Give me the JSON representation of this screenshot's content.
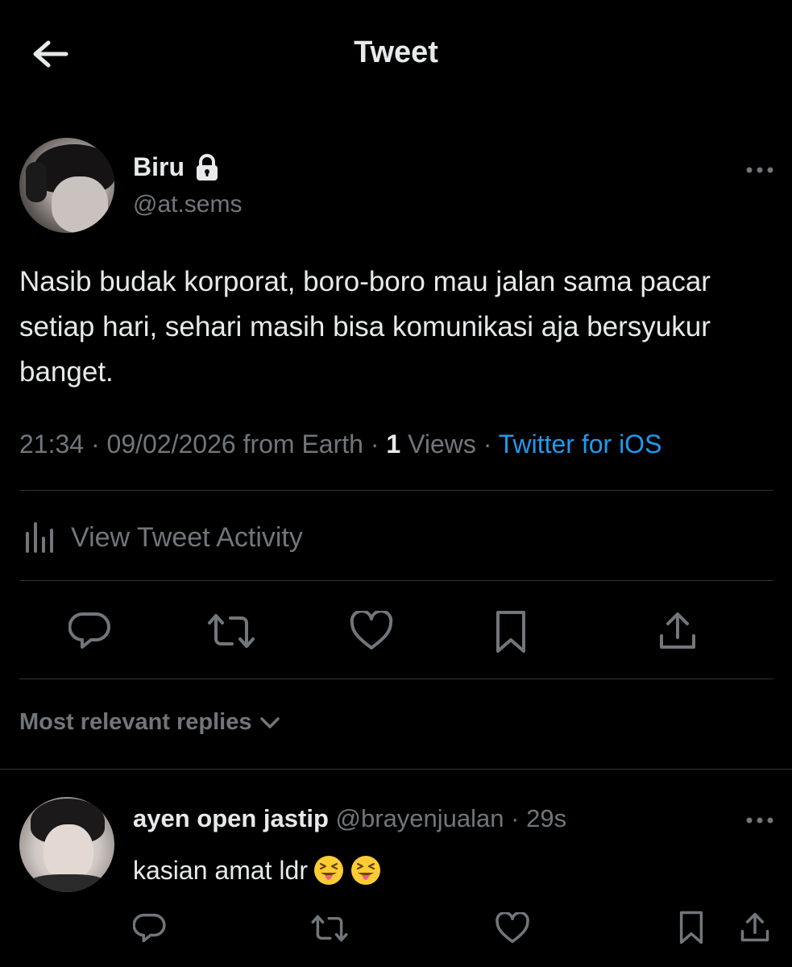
{
  "header": {
    "title": "Tweet",
    "back_icon": "arrow-left-icon"
  },
  "tweet": {
    "author": {
      "name": "Biru",
      "handle": "@at.sems",
      "protected_icon": "lock-icon"
    },
    "text": "Nasib budak korporat, boro-boro mau jalan sama pacar setiap hari, sehari masih bisa komunikasi aja bersyukur banget.",
    "time": "21:34",
    "sep1": " · ",
    "date": "09/02/2026 from Earth",
    "sep2": " · ",
    "views_count": "1",
    "views_label": " Views",
    "sep3": " · ",
    "source": "Twitter for iOS",
    "activity_label": "View Tweet Activity",
    "actions": [
      "reply-icon",
      "retweet-icon",
      "like-icon",
      "bookmark-icon",
      "share-icon"
    ]
  },
  "replies": {
    "sort_label": "Most relevant replies",
    "items": [
      {
        "name": "ayen open jastip",
        "handle": "@brayenjualan",
        "sep": " · ",
        "time": "29s",
        "text": "kasian amat ldr",
        "emojis": [
          "squinting-face-with-tongue",
          "squinting-face-with-tongue"
        ]
      }
    ]
  },
  "colors": {
    "background": "#000000",
    "text": "#e7e9ea",
    "muted": "#71767b",
    "link": "#1d9bf0",
    "divider": "#2f3336"
  }
}
